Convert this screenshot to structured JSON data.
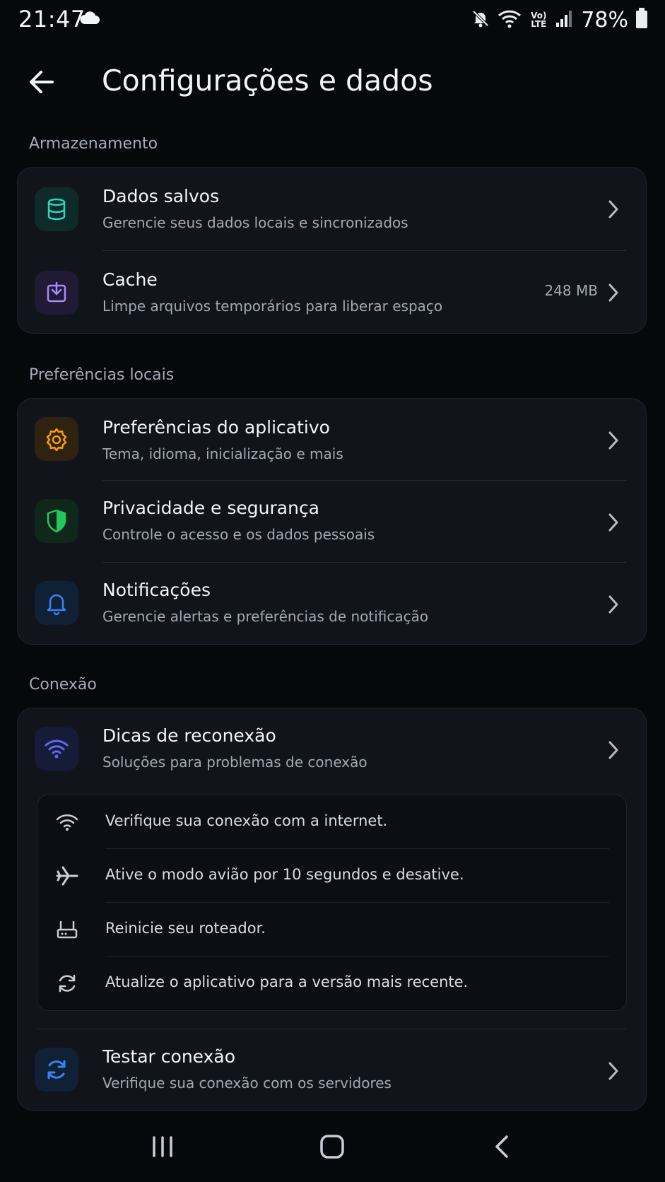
{
  "status_bar": {
    "time": "21:47",
    "network_label": "Vo) LTE",
    "battery": "78%"
  },
  "header": {
    "title": "Configurações e dados"
  },
  "sections": {
    "storage": {
      "label": "Armazenamento",
      "items": [
        {
          "title": "Dados salvos",
          "subtitle": "Gerencie seus dados locais e sincronizados",
          "icon": "database-icon",
          "color": "#2dd4bf"
        },
        {
          "title": "Cache",
          "subtitle": "Limpe arquivos temporários para liberar espaço",
          "value": "248 MB",
          "icon": "download-box-icon",
          "color": "#a78bfa"
        }
      ]
    },
    "local_prefs": {
      "label": "Preferências locais",
      "items": [
        {
          "title": "Preferências do aplicativo",
          "subtitle": "Tema, idioma, inicialização e mais",
          "icon": "gear-icon",
          "color": "#f59e0b"
        },
        {
          "title": "Privacidade e segurança",
          "subtitle": "Controle o acesso e os dados pessoais",
          "icon": "shield-icon",
          "color": "#22c55e"
        },
        {
          "title": "Notificações",
          "subtitle": "Gerencie alertas e preferências de notificação",
          "icon": "bell-icon",
          "color": "#3b82f6"
        }
      ]
    },
    "connection": {
      "label": "Conexão",
      "reconnect": {
        "title": "Dicas de reconexão",
        "subtitle": "Soluções para problemas de conexão",
        "icon": "wifi-icon",
        "color": "#6366f1"
      },
      "tips": [
        {
          "text": "Verifique sua conexão com a internet.",
          "icon": "wifi-icon"
        },
        {
          "text": "Ative o modo avião por 10 segundos e desative.",
          "icon": "airplane-icon"
        },
        {
          "text": "Reinicie seu roteador.",
          "icon": "router-icon"
        },
        {
          "text": "Atualize o aplicativo para a versão mais recente.",
          "icon": "refresh-icon"
        }
      ],
      "test": {
        "title": "Testar conexão",
        "subtitle": "Verifique sua conexão com os servidores",
        "icon": "sync-icon",
        "color": "#3b82f6"
      }
    }
  }
}
